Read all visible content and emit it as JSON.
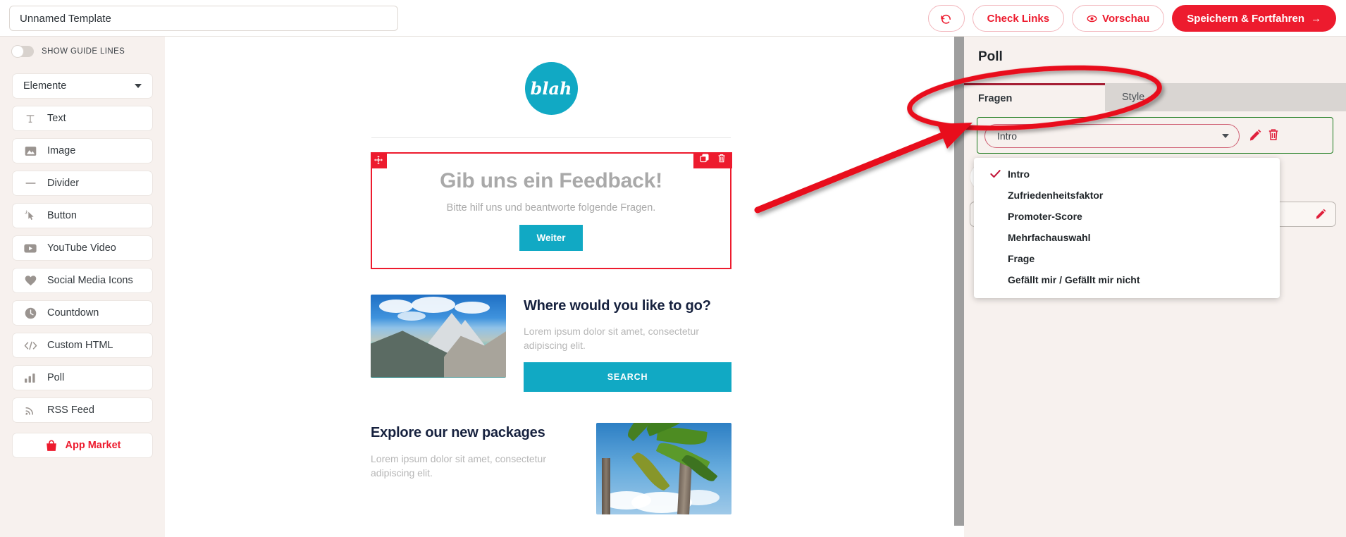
{
  "topbar": {
    "template_name_value": "Unnamed Template",
    "template_name_placeholder": "Unnamed Template",
    "undo_label": "",
    "check_links_label": "Check Links",
    "preview_label": "Vorschau",
    "save_label": "Speichern & Fortfahren",
    "save_arrow": "→"
  },
  "sidebar": {
    "guide_lines_label": "SHOW GUIDE LINES",
    "guide_lines_on": false,
    "category_select": "Elemente",
    "items": [
      {
        "label": "Text",
        "icon": "text-icon"
      },
      {
        "label": "Image",
        "icon": "image-icon"
      },
      {
        "label": "Divider",
        "icon": "divider-icon"
      },
      {
        "label": "Button",
        "icon": "button-cursor-icon"
      },
      {
        "label": "YouTube Video",
        "icon": "youtube-icon"
      },
      {
        "label": "Social Media Icons",
        "icon": "heart-icon"
      },
      {
        "label": "Countdown",
        "icon": "clock-icon"
      },
      {
        "label": "Custom HTML",
        "icon": "code-icon"
      },
      {
        "label": "Poll",
        "icon": "bar-chart-icon"
      },
      {
        "label": "RSS Feed",
        "icon": "rss-icon"
      }
    ],
    "app_market_label": "App Market"
  },
  "canvas": {
    "logo_text": "blah",
    "poll_block": {
      "title": "Gib uns ein Feedback!",
      "subtitle": "Bitte hilf uns und beantworte folgende Fragen.",
      "button_label": "Weiter"
    },
    "sections": [
      {
        "heading": "Where would you like to go?",
        "body": "Lorem ipsum dolor sit amet, consectetur adipiscing elit.",
        "button_label": "SEARCH",
        "image": "mountain-lake-photo"
      },
      {
        "heading": "Explore our new packages",
        "body": "Lorem ipsum dolor sit amet, consectetur adipiscing elit.",
        "image": "palm-tree-photo"
      }
    ]
  },
  "panel": {
    "title": "Poll",
    "tabs": [
      {
        "label": "Fragen",
        "active": true
      },
      {
        "label": "Style",
        "active": false
      }
    ],
    "question_select_value": "Intro",
    "dropdown_options": [
      {
        "label": "Intro",
        "selected": true
      },
      {
        "label": "Zufriedenheitsfaktor",
        "selected": false
      },
      {
        "label": "Promoter-Score",
        "selected": false
      },
      {
        "label": "Mehrfachauswahl",
        "selected": false
      },
      {
        "label": "Frage",
        "selected": false
      },
      {
        "label": "Gefällt mir / Gefällt mir nicht",
        "selected": false
      }
    ]
  },
  "colors": {
    "brand_red": "#ed1b2e",
    "teal_accent": "#11a9c4",
    "panel_bg": "#f7f1ee",
    "tab_underline": "#a51e34",
    "highlight_green": "#1b7a1b",
    "annotation_red": "#e8111f"
  }
}
